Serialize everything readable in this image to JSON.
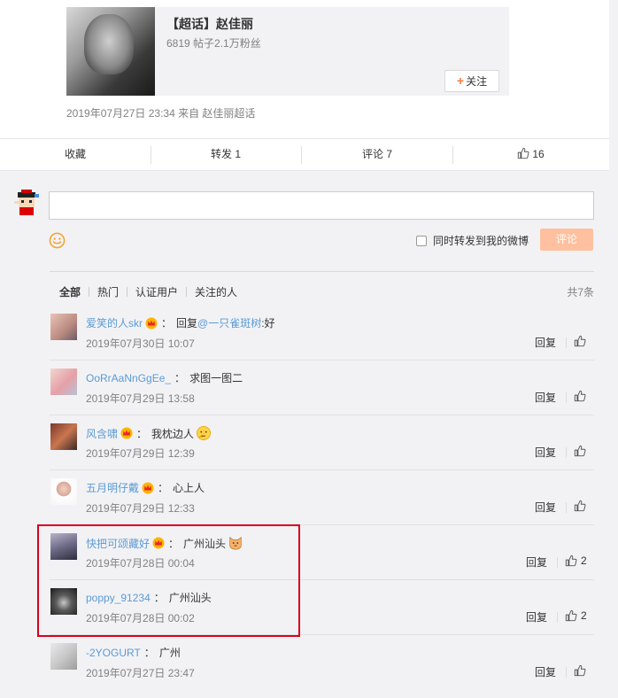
{
  "topic": {
    "title": "【超话】赵佳丽",
    "stats": "6819 帖子2.1万粉丝",
    "follow_label": "关注"
  },
  "post": {
    "meta": "2019年07月27日 23:34  来自 赵佳丽超话"
  },
  "actions": {
    "favorite": "收藏",
    "repost": "转发 1",
    "comment": "评论 7",
    "like_count": "16"
  },
  "composer": {
    "repost_label": "同时转发到我的微博",
    "submit_label": "评论"
  },
  "filter": {
    "tabs": [
      "全部",
      "热门",
      "认证用户",
      "关注的人"
    ],
    "total": "共7条"
  },
  "comments": [
    {
      "user": "爱笑的人skr",
      "vip": true,
      "prefix": "回复",
      "mention": "@一只雀斑树",
      "text": ":好",
      "time": "2019年07月30日 10:07",
      "reply": "回复",
      "likes": ""
    },
    {
      "user": "OoRrAaNnGgEe_",
      "vip": false,
      "prefix": "",
      "mention": "",
      "text": "求图一图二",
      "time": "2019年07月29日 13:58",
      "reply": "回复",
      "likes": ""
    },
    {
      "user": "风含啸",
      "vip": true,
      "prefix": "",
      "mention": "",
      "text": "我枕边人",
      "time": "2019年07月29日 12:39",
      "reply": "回复",
      "likes": ""
    },
    {
      "user": "五月明仔戴",
      "vip": true,
      "prefix": "",
      "mention": "",
      "text": "心上人",
      "time": "2019年07月29日 12:33",
      "reply": "回复",
      "likes": ""
    },
    {
      "user": "快把可颂藏好",
      "vip": true,
      "prefix": "",
      "mention": "",
      "text": "广州汕头",
      "time": "2019年07月28日 00:04",
      "reply": "回复",
      "likes": "2"
    },
    {
      "user": "poppy_91234",
      "vip": false,
      "prefix": "",
      "mention": "",
      "text": "广州汕头",
      "time": "2019年07月28日 00:02",
      "reply": "回复",
      "likes": "2"
    },
    {
      "user": "-2YOGURT",
      "vip": false,
      "prefix": "",
      "mention": "",
      "text": "广州",
      "time": "2019年07月27日 23:47",
      "reply": "回复",
      "likes": ""
    }
  ],
  "colors": {
    "link": "#5b9bd5",
    "accent": "#fa7d3c",
    "submit_disabled": "#ffc09f",
    "highlight": "#d9001b"
  }
}
